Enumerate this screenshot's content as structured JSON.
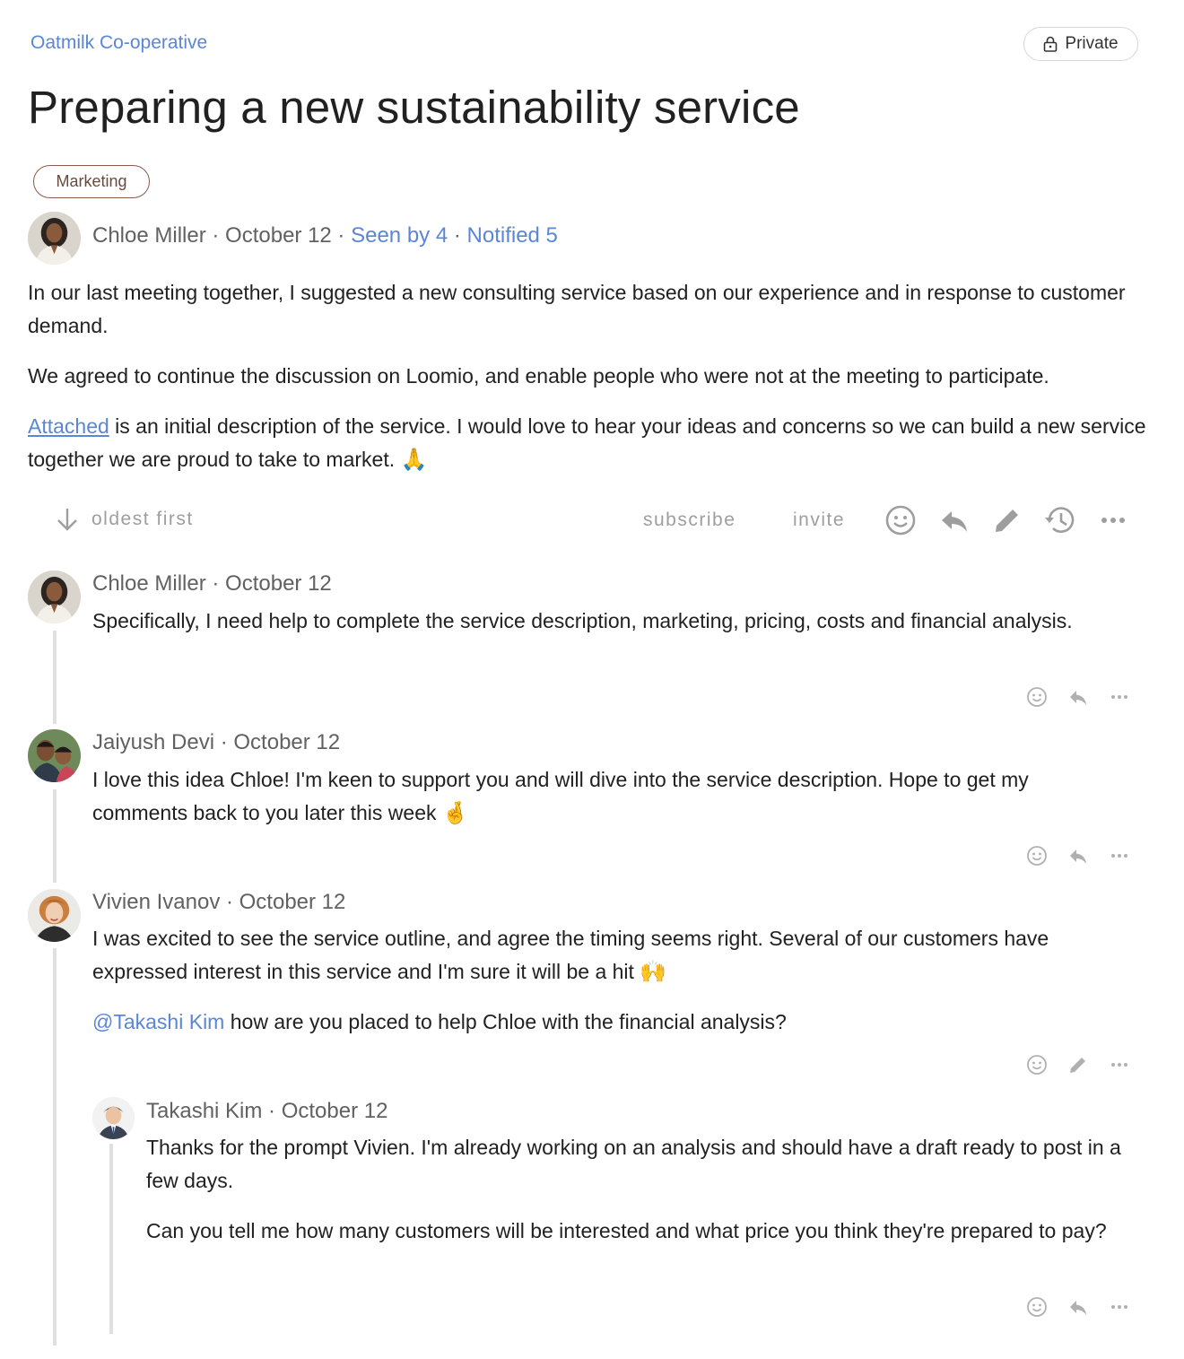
{
  "group_name": "Oatmilk Co-operative",
  "privacy_label": "Private",
  "title": "Preparing a new sustainability service",
  "tag": "Marketing",
  "discussion": {
    "author": "Chloe Miller",
    "date": "October 12",
    "seen_by": "Seen by 4",
    "notified": "Notified 5",
    "para1": "In our last meeting together, I suggested a new consulting service based on our experience and in response to customer demand.",
    "para2": "We agreed to continue the discussion on Loomio, and enable people who were not at the meeting to participate.",
    "para3_link": "Attached",
    "para3_rest": " is an initial description of the service. I would love to hear your ideas and concerns so we can build a new service together we are proud to take to market. ",
    "para3_emoji": "🙏"
  },
  "toolbar": {
    "sort_label": "oldest first",
    "subscribe_label": "subscribe",
    "invite_label": "invite"
  },
  "comments": [
    {
      "author": "Chloe Miller",
      "date": "October 12",
      "text": "Specifically, I need help to complete the service description, marketing, pricing, costs and financial analysis."
    },
    {
      "author": "Jaiyush Devi",
      "date": "October 12",
      "text": "I love this idea Chloe! I'm keen to support you and will dive into the service description. Hope to get my comments back to you later this week ",
      "emoji": "🤞"
    },
    {
      "author": "Vivien Ivanov",
      "date": "October 12",
      "text": "I was excited to see the service outline, and agree the timing seems right. Several of our customers have expressed interest in this service and I'm sure it will be a hit ",
      "emoji": "🙌",
      "mention": "@Takashi Kim",
      "text2": " how are you placed to help Chloe with the financial analysis?"
    },
    {
      "author": "Takashi Kim",
      "date": "October 12",
      "text": "Thanks for the prompt Vivien. I'm already working on an analysis and should have a draft ready to post in a few days.",
      "text2": "Can you tell me how many customers will be interested and what price you think they're prepared to pay?"
    }
  ],
  "separator": " · ",
  "icons": [
    "lock-icon",
    "arrow-down-icon",
    "emoji-icon",
    "reply-icon",
    "edit-icon",
    "history-icon",
    "more-icon"
  ]
}
